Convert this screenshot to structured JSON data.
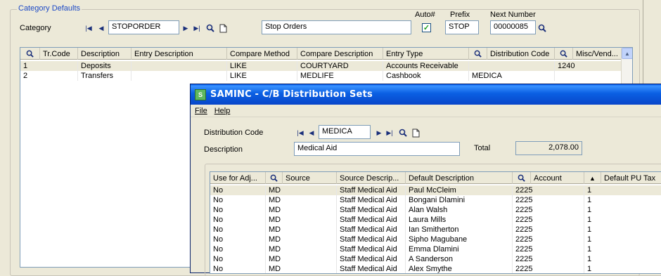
{
  "category_defaults": {
    "legend": "Category Defaults",
    "category_label": "Category",
    "category_value": "STOPORDER",
    "category_desc": "Stop Orders",
    "auto_label": "Auto#",
    "auto_checked": true,
    "prefix_label": "Prefix",
    "prefix_value": "STOP",
    "next_number_label": "Next Number",
    "next_number_value": "00000085"
  },
  "category_grid": {
    "columns": [
      "Tr.Code",
      "Description",
      "Entry Description",
      "Compare Method",
      "Compare Description",
      "Entry Type",
      "Distribution Code",
      "Misc/Vend..."
    ],
    "rows": [
      {
        "tr_code": "1",
        "description": "Deposits",
        "entry_description": "",
        "compare_method": "LIKE",
        "compare_description": "COURTYARD",
        "entry_type": "Accounts Receivable",
        "distribution_code": "",
        "misc": "1240"
      },
      {
        "tr_code": "2",
        "description": "Transfers",
        "entry_description": "",
        "compare_method": "LIKE",
        "compare_description": "MEDLIFE",
        "entry_type": "Cashbook",
        "distribution_code": "MEDICA",
        "misc": ""
      }
    ]
  },
  "dialog": {
    "title": "SAMINC - C/B Distribution Sets",
    "menu": {
      "file": "File",
      "help": "Help"
    },
    "distribution_code_label": "Distribution Code",
    "distribution_code_value": "MEDICA",
    "description_label": "Description",
    "description_value": "Medical Aid",
    "total_label": "Total",
    "total_value": "2,078.00",
    "grid": {
      "columns": [
        "Use for Adj...",
        "Source",
        "Source Descrip...",
        "Default Description",
        "Account",
        "Default PU Tax"
      ],
      "rows": [
        {
          "use_for_adj": "No",
          "source": "MD",
          "source_desc": "Staff Medical Aid",
          "default_desc": "Paul McCleim",
          "account": "2225",
          "pu_tax": "1"
        },
        {
          "use_for_adj": "No",
          "source": "MD",
          "source_desc": "Staff Medical Aid",
          "default_desc": "Bongani Dlamini",
          "account": "2225",
          "pu_tax": "1"
        },
        {
          "use_for_adj": "No",
          "source": "MD",
          "source_desc": "Staff Medical Aid",
          "default_desc": "Alan Walsh",
          "account": "2225",
          "pu_tax": "1"
        },
        {
          "use_for_adj": "No",
          "source": "MD",
          "source_desc": "Staff Medical Aid",
          "default_desc": "Laura Mills",
          "account": "2225",
          "pu_tax": "1"
        },
        {
          "use_for_adj": "No",
          "source": "MD",
          "source_desc": "Staff Medical Aid",
          "default_desc": "Ian Smitherton",
          "account": "2225",
          "pu_tax": "1"
        },
        {
          "use_for_adj": "No",
          "source": "MD",
          "source_desc": "Staff Medical Aid",
          "default_desc": "Sipho Magubane",
          "account": "2225",
          "pu_tax": "1"
        },
        {
          "use_for_adj": "No",
          "source": "MD",
          "source_desc": "Staff Medical Aid",
          "default_desc": "Emma Dlamini",
          "account": "2225",
          "pu_tax": "1"
        },
        {
          "use_for_adj": "No",
          "source": "MD",
          "source_desc": "Staff Medical Aid",
          "default_desc": "A Sanderson",
          "account": "2225",
          "pu_tax": "1"
        },
        {
          "use_for_adj": "No",
          "source": "MD",
          "source_desc": "Staff Medical Aid",
          "default_desc": "Alex Smythe",
          "account": "2225",
          "pu_tax": "1"
        }
      ]
    }
  },
  "colors": {
    "accent": "#1c49c6",
    "titlebar": "#0a5fe3",
    "check": "#21a121"
  }
}
